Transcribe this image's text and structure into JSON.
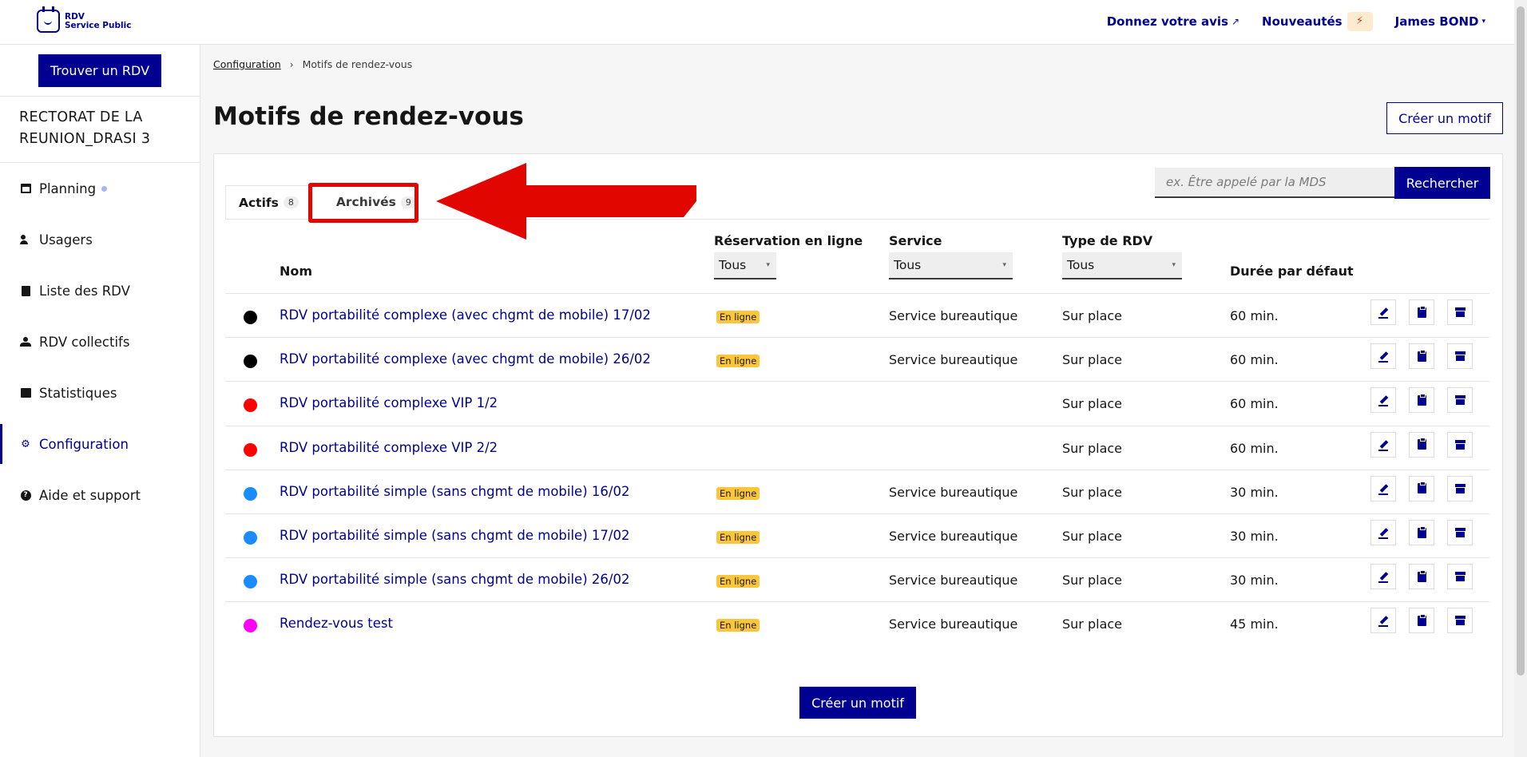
{
  "logo": {
    "line1": "RDV",
    "line2": "Service Public"
  },
  "header": {
    "feedback_label": "Donnez votre avis",
    "news_label": "Nouveautés",
    "news_icon": "⚡",
    "user_label": "James BOND"
  },
  "sidebar": {
    "find_button": "Trouver un RDV",
    "organisation_line1": "RECTORAT DE LA",
    "organisation_line2": "REUNION_DRASI 3",
    "items": [
      {
        "label": "Planning",
        "icon": "calendar-icon"
      },
      {
        "label": "Usagers",
        "icon": "users-icon"
      },
      {
        "label": "Liste des RDV",
        "icon": "list-icon"
      },
      {
        "label": "RDV collectifs",
        "icon": "group-icon"
      },
      {
        "label": "Statistiques",
        "icon": "stats-icon"
      },
      {
        "label": "Configuration",
        "icon": "gear-icon",
        "active": true
      },
      {
        "label": "Aide et support",
        "icon": "help-icon"
      }
    ]
  },
  "breadcrumb": {
    "parent": "Configuration",
    "separator": "›",
    "current": "Motifs de rendez-vous"
  },
  "page": {
    "title": "Motifs de rendez-vous",
    "create_button": "Créer un motif"
  },
  "tabs": [
    {
      "label": "Actifs",
      "count": "8",
      "active": true
    },
    {
      "label": "Archivés",
      "count": "9",
      "active": false
    }
  ],
  "search": {
    "placeholder": "ex. Être appelé par la MDS",
    "button": "Rechercher"
  },
  "table": {
    "headers": {
      "name": "Nom",
      "online": "Réservation en ligne",
      "service": "Service",
      "type": "Type de RDV",
      "duration": "Durée par défaut"
    },
    "filters": {
      "online": "Tous",
      "service": "Tous",
      "type": "Tous"
    },
    "rows": [
      {
        "color": "#000000",
        "name": "RDV portabilité complexe (avec chgmt de mobile) 17/02",
        "online": "En ligne",
        "service": "Service bureautique",
        "type": "Sur place",
        "duration": "60 min."
      },
      {
        "color": "#000000",
        "name": "RDV portabilité complexe (avec chgmt de mobile) 26/02",
        "online": "En ligne",
        "service": "Service bureautique",
        "type": "Sur place",
        "duration": "60 min."
      },
      {
        "color": "#ff0000",
        "name": "RDV portabilité complexe VIP 1/2",
        "online": "",
        "service": "",
        "type": "Sur place",
        "duration": "60 min."
      },
      {
        "color": "#ff0000",
        "name": "RDV portabilité complexe VIP 2/2",
        "online": "",
        "service": "",
        "type": "Sur place",
        "duration": "60 min."
      },
      {
        "color": "#1a8cff",
        "name": "RDV portabilité simple (sans chgmt de mobile) 16/02",
        "online": "En ligne",
        "service": "Service bureautique",
        "type": "Sur place",
        "duration": "30 min."
      },
      {
        "color": "#1a8cff",
        "name": "RDV portabilité simple (sans chgmt de mobile) 17/02",
        "online": "En ligne",
        "service": "Service bureautique",
        "type": "Sur place",
        "duration": "30 min."
      },
      {
        "color": "#1a8cff",
        "name": "RDV portabilité simple (sans chgmt de mobile) 26/02",
        "online": "En ligne",
        "service": "Service bureautique",
        "type": "Sur place",
        "duration": "30 min."
      },
      {
        "color": "#ff00ff",
        "name": "Rendez-vous test",
        "online": "En ligne",
        "service": "Service bureautique",
        "type": "Sur place",
        "duration": "45 min."
      }
    ]
  },
  "bottom": {
    "create_button": "Créer un motif"
  },
  "colors": {
    "primary": "#000091",
    "badge": "#fcc63a",
    "annotation": "#e10600"
  }
}
